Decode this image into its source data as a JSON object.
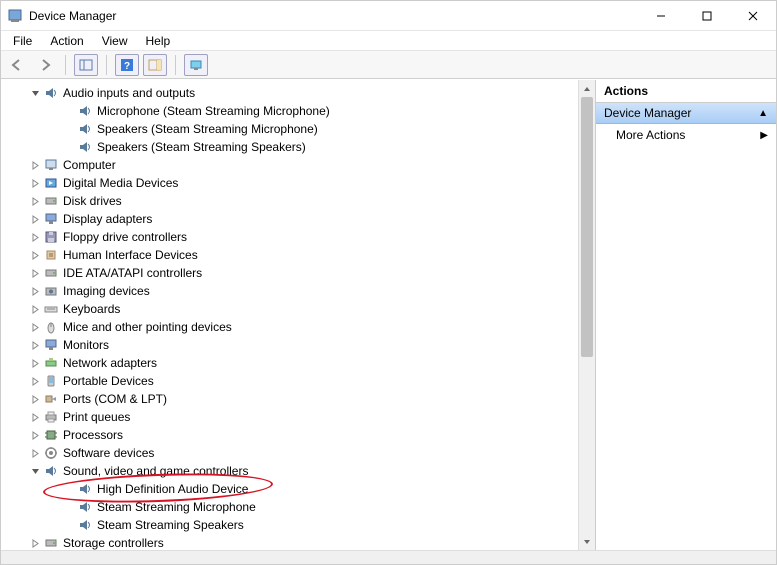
{
  "title": "Device Manager",
  "menu": {
    "file": "File",
    "action": "Action",
    "view": "View",
    "help": "Help"
  },
  "tree": {
    "audio": {
      "label": "Audio inputs and outputs",
      "children": [
        "Microphone (Steam Streaming Microphone)",
        "Speakers (Steam Streaming Microphone)",
        "Speakers (Steam Streaming Speakers)"
      ]
    },
    "categories": [
      "Computer",
      "Digital Media Devices",
      "Disk drives",
      "Display adapters",
      "Floppy drive controllers",
      "Human Interface Devices",
      "IDE ATA/ATAPI controllers",
      "Imaging devices",
      "Keyboards",
      "Mice and other pointing devices",
      "Monitors",
      "Network adapters",
      "Portable Devices",
      "Ports (COM & LPT)",
      "Print queues",
      "Processors",
      "Software devices"
    ],
    "sound": {
      "label": "Sound, video and game controllers",
      "children": [
        "High Definition Audio Device",
        "Steam Streaming Microphone",
        "Steam Streaming Speakers"
      ]
    },
    "tail": "Storage controllers"
  },
  "actions": {
    "header": "Actions",
    "section": "Device Manager",
    "more": "More Actions"
  },
  "icons": {
    "speaker": "speaker-icon",
    "computer": "computer-icon",
    "generic": "device-icon"
  }
}
